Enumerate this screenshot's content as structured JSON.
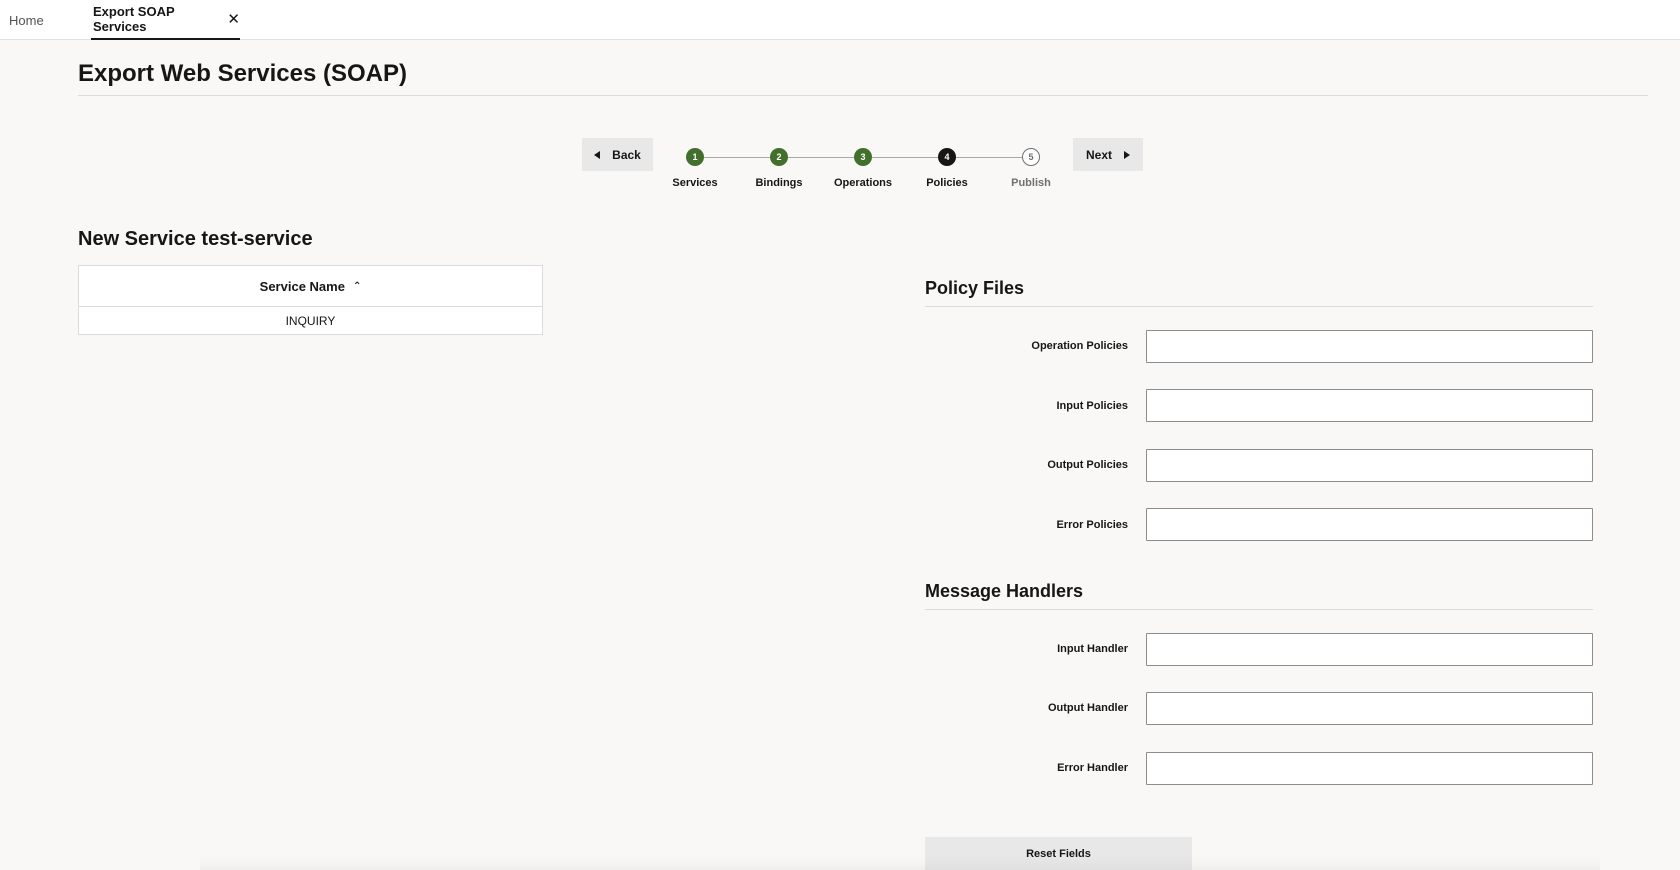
{
  "tabs": {
    "home_label": "Home",
    "active_label": "Export SOAP Services",
    "close_glyph": "✕"
  },
  "page": {
    "title": "Export Web Services (SOAP)"
  },
  "wizard": {
    "back_label": "Back",
    "next_label": "Next",
    "steps": [
      {
        "number": "1",
        "label": "Services",
        "state": "done"
      },
      {
        "number": "2",
        "label": "Bindings",
        "state": "done"
      },
      {
        "number": "3",
        "label": "Operations",
        "state": "done"
      },
      {
        "number": "4",
        "label": "Policies",
        "state": "current"
      },
      {
        "number": "5",
        "label": "Publish",
        "state": "future"
      }
    ]
  },
  "service": {
    "heading": "New Service test-service",
    "column_header": "Service Name",
    "sort_icon": "chevron-up-icon",
    "rows": [
      "INQUIRY"
    ]
  },
  "policy_files": {
    "heading": "Policy Files",
    "fields": [
      {
        "label": "Operation Policies",
        "value": ""
      },
      {
        "label": "Input Policies",
        "value": ""
      },
      {
        "label": "Output Policies",
        "value": ""
      },
      {
        "label": "Error Policies",
        "value": ""
      }
    ]
  },
  "message_handlers": {
    "heading": "Message Handlers",
    "fields": [
      {
        "label": "Input Handler",
        "value": ""
      },
      {
        "label": "Output Handler",
        "value": ""
      },
      {
        "label": "Error Handler",
        "value": ""
      }
    ]
  },
  "actions": {
    "reset_label": "Reset Fields"
  },
  "colors": {
    "step_done": "#42702c",
    "step_current": "#161616",
    "background": "#f9f8f6"
  }
}
